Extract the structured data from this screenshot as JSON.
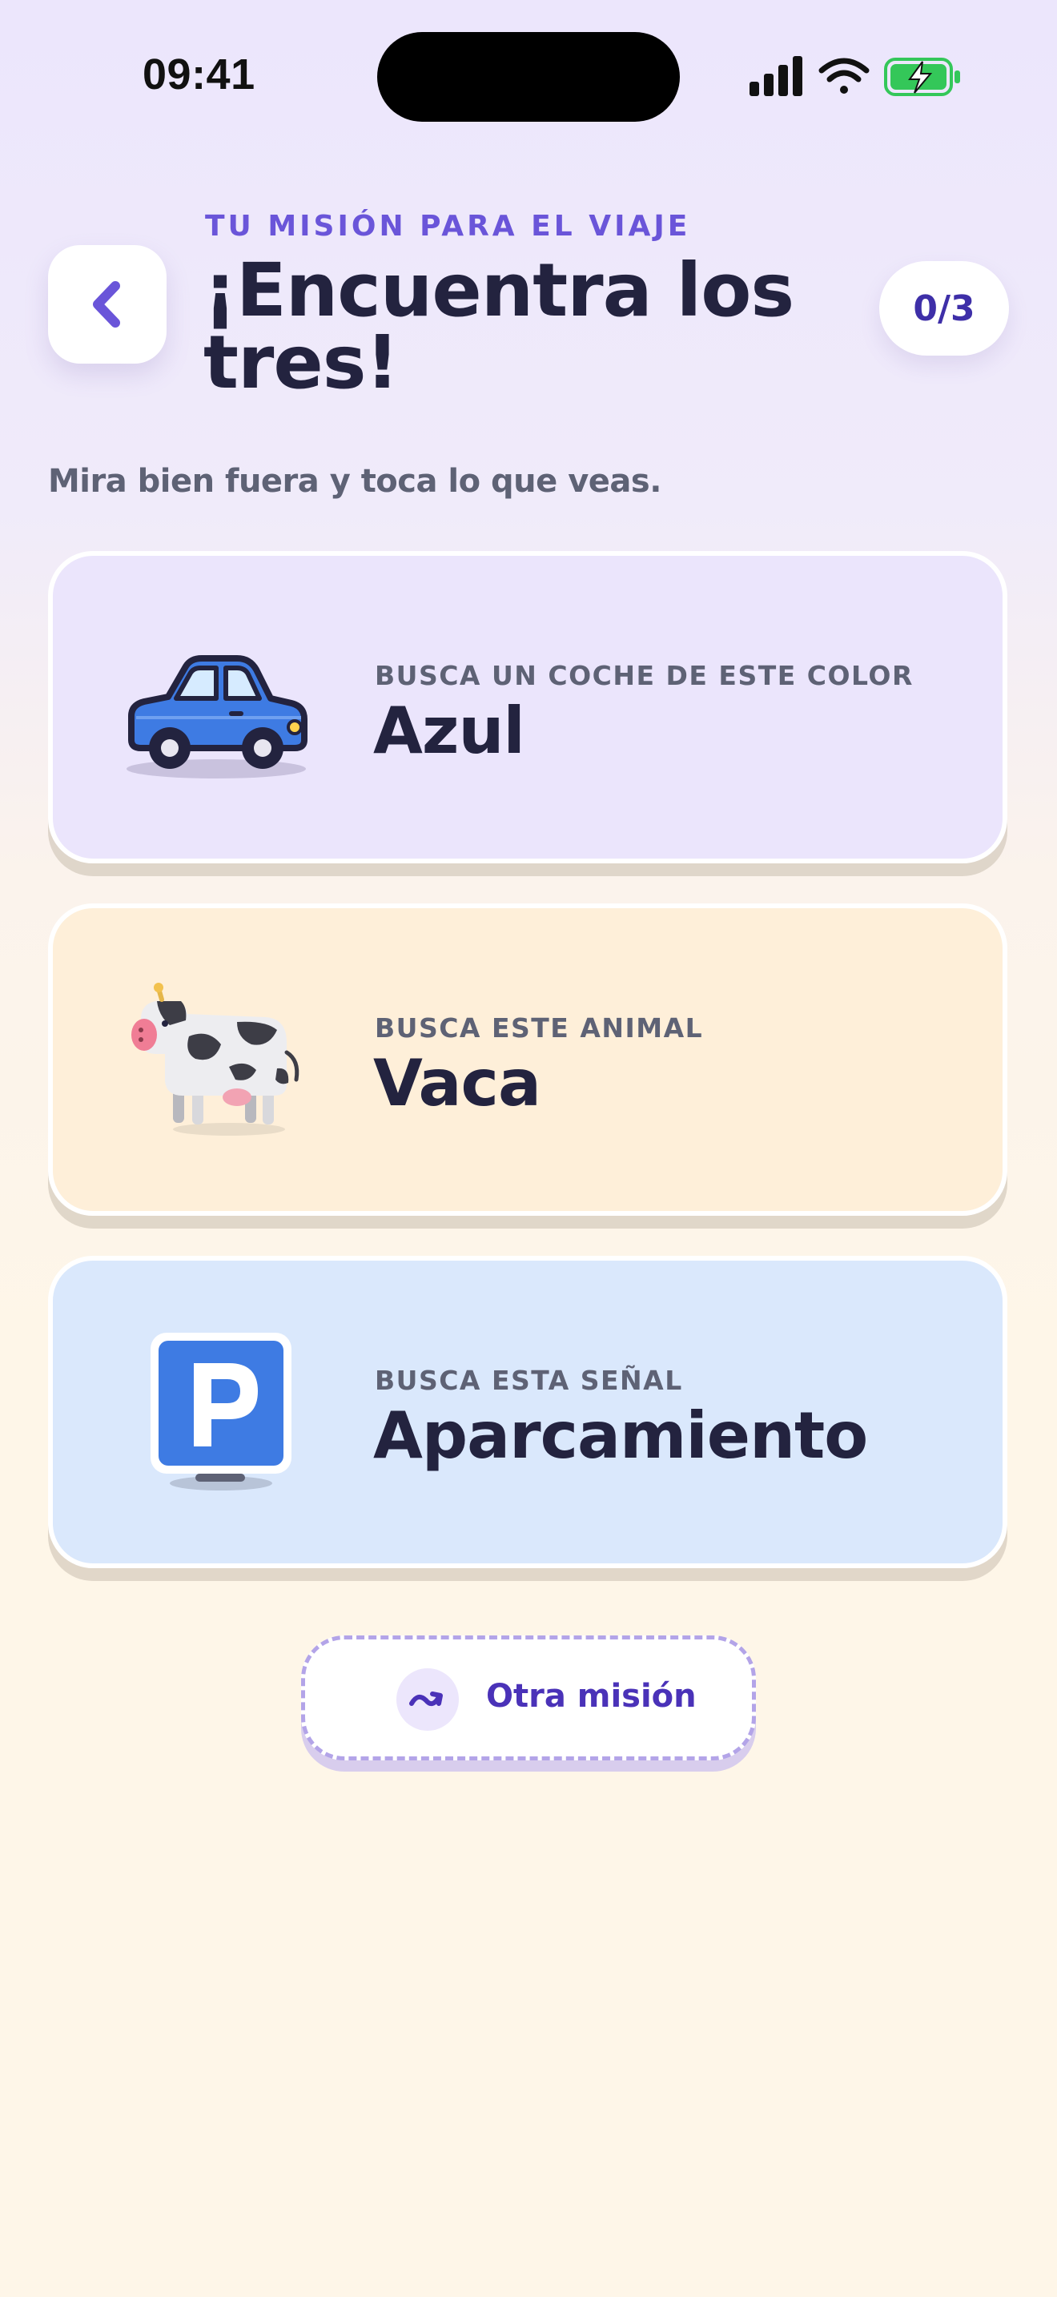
{
  "status_bar": {
    "time": "09:41"
  },
  "header": {
    "kicker": "TU MISIÓN PARA EL VIAJE",
    "title": "¡Encuentra los tres!",
    "progress": "0/3",
    "subtitle": "Mira bien fuera y toca lo que veas."
  },
  "missions": [
    {
      "label": "BUSCA UN COCHE DE ESTE COLOR",
      "value": "Azul",
      "icon": "blue-car-icon",
      "color": "#EBE5FC"
    },
    {
      "label": "BUSCA ESTE ANIMAL",
      "value": "Vaca",
      "icon": "cow-icon",
      "color": "#FEEFD9"
    },
    {
      "label": "BUSCA ESTA SEÑAL",
      "value": "Aparcamiento",
      "icon": "parking-sign-icon",
      "color": "#DAE8FC"
    }
  ],
  "other_mission": {
    "label": "Otra misión",
    "icon": "shuffle-icon"
  },
  "colors": {
    "accent": "#6A55D9",
    "text": "#23233F",
    "muted": "#5E6275"
  }
}
